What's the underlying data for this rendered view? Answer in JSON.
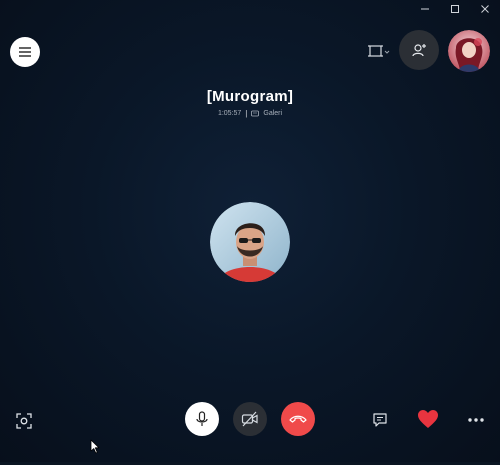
{
  "window": {
    "controls": [
      "minimize",
      "maximize",
      "close"
    ]
  },
  "call": {
    "title": "[Murogram]",
    "duration": "1:05:57",
    "separator": "|",
    "group_label": "Galeri"
  },
  "icons": {
    "menu": "hamburger-icon",
    "layout": "call-layout-icon",
    "add_people": "add-person-icon",
    "screenshot": "camera-capture-icon",
    "mic": "microphone-icon",
    "video": "video-off-icon",
    "hangup": "hangup-icon",
    "chat": "chat-icon",
    "react": "heart-icon",
    "more": "ellipsis-icon"
  },
  "colors": {
    "background": "#0a1728",
    "hangup": "#f04a4a",
    "heart": "#e8343f",
    "dark_button": "#2b2f35"
  }
}
